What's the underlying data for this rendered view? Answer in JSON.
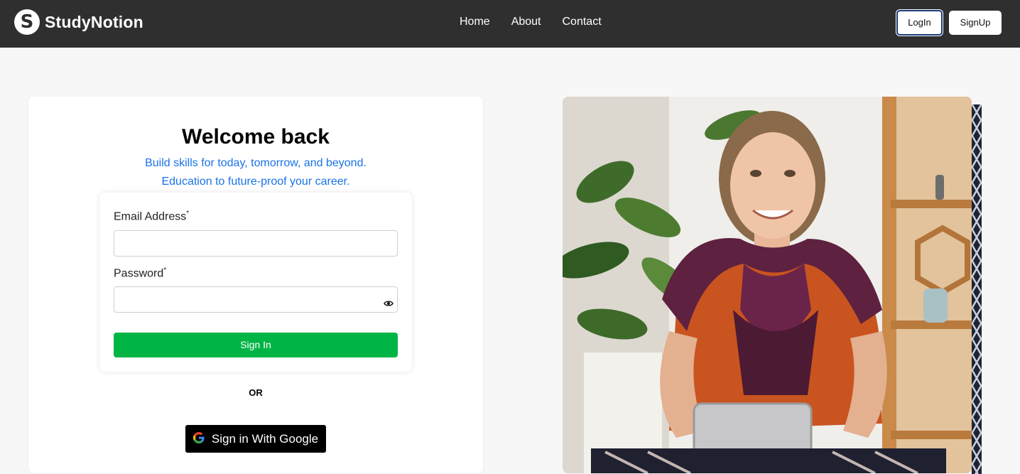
{
  "navbar": {
    "logo_mark": "S",
    "logo_text": "StudyNotion",
    "links": [
      "Home",
      "About",
      "Contact"
    ],
    "login_label": "LogIn",
    "signup_label": "SignUp"
  },
  "login": {
    "title": "Welcome back",
    "subtitle_line1": "Build skills for today, tomorrow, and beyond.",
    "subtitle_line2": "Education to future-proof your career.",
    "email_label": "Email Address",
    "password_label": "Password",
    "required_mark": "*",
    "email_value": "",
    "password_value": "",
    "signin_label": "Sign In",
    "or_text": "OR",
    "google_label": "Sign in With Google"
  },
  "icons": {
    "password_toggle": "eye-icon",
    "google": "google-icon"
  },
  "colors": {
    "navbar_bg": "#2f2f2f",
    "subtitle_blue": "#1a73e8",
    "signin_green": "#00b545",
    "google_button_bg": "#000000"
  }
}
